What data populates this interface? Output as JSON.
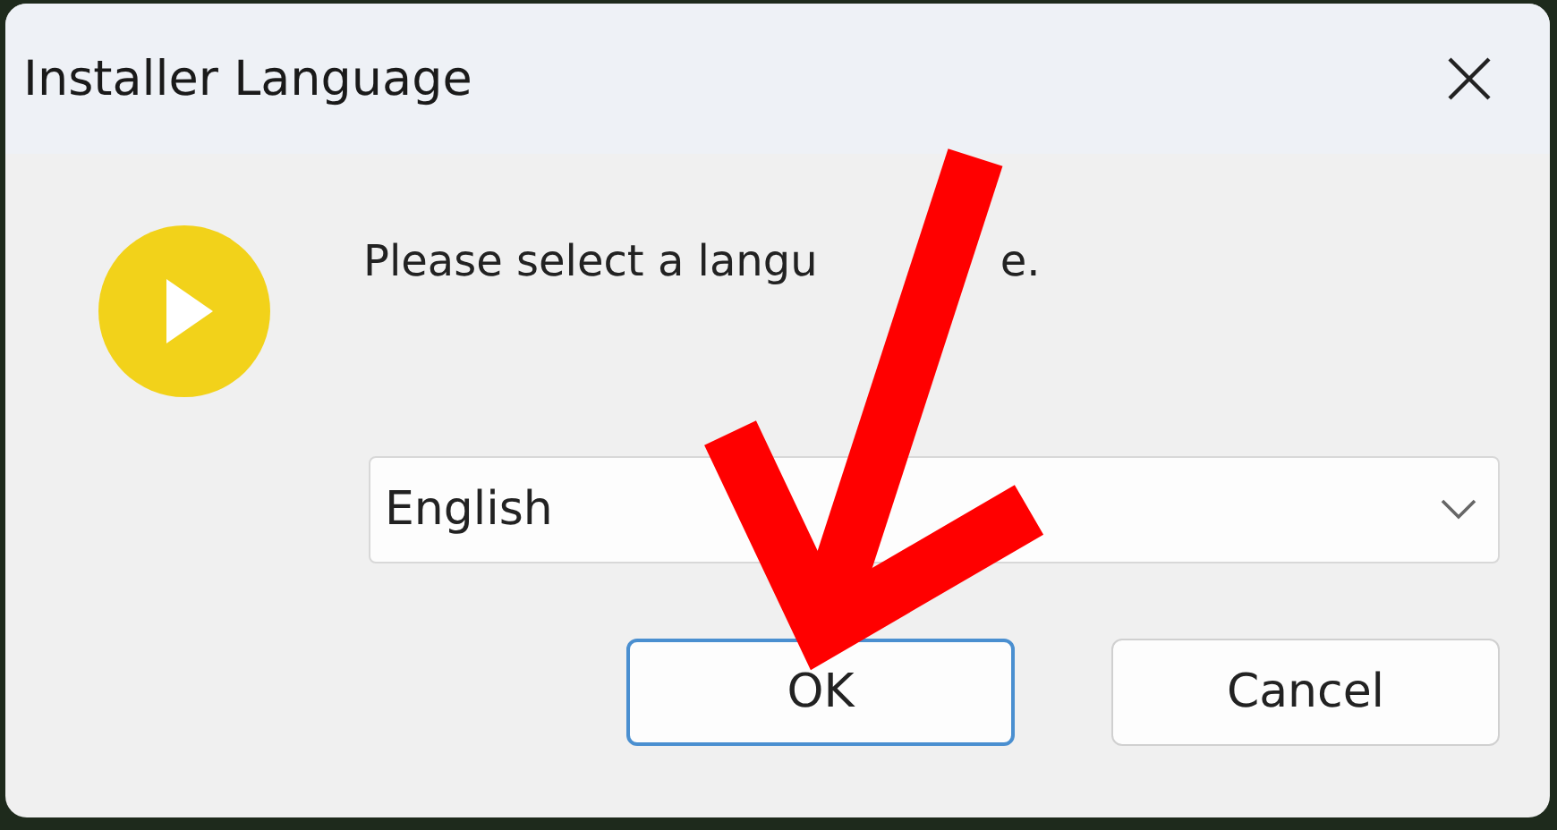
{
  "window": {
    "title": "Installer Language"
  },
  "message_parts": [
    "Please select a langu",
    "e."
  ],
  "language_select": {
    "value": "English"
  },
  "buttons": [
    {
      "label": "OK",
      "default": true
    },
    {
      "label": "Cancel",
      "default": false
    }
  ],
  "annotation": {
    "kind": "arrow",
    "color": "#ff0000"
  }
}
